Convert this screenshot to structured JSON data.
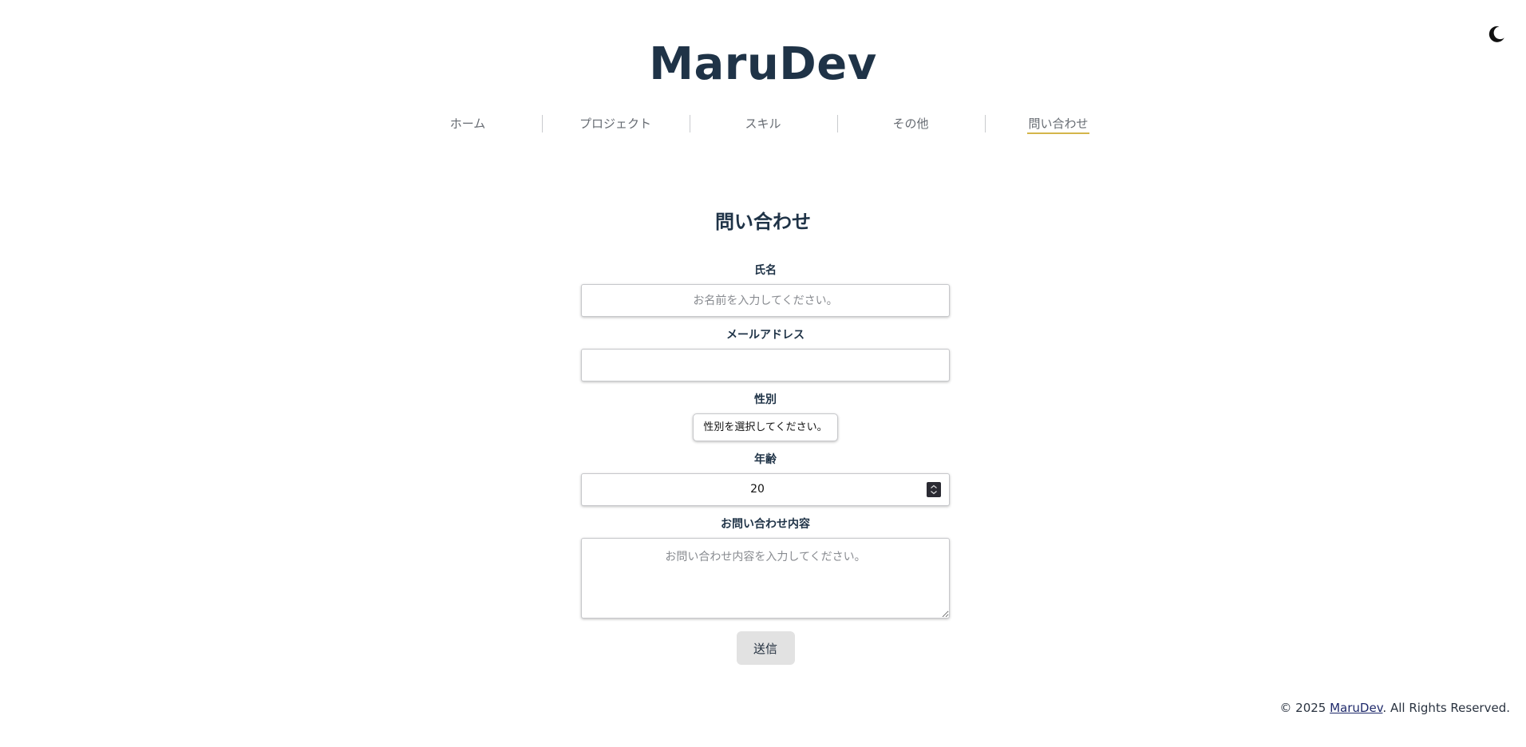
{
  "header": {
    "site_title": "MaruDev",
    "theme_toggle_icon": "moon-icon"
  },
  "nav": {
    "items": [
      {
        "label": "ホーム",
        "active": false
      },
      {
        "label": "プロジェクト",
        "active": false
      },
      {
        "label": "スキル",
        "active": false
      },
      {
        "label": "その他",
        "active": false
      },
      {
        "label": "問い合わせ",
        "active": true
      }
    ],
    "active_underline_color": "#d4b64a"
  },
  "contact": {
    "heading": "問い合わせ",
    "name": {
      "label": "氏名",
      "value": "",
      "placeholder": "お名前を入力してください。"
    },
    "email": {
      "label": "メールアドレス",
      "value": "",
      "placeholder": ""
    },
    "gender": {
      "label": "性別",
      "selected": "性別を選択してください。"
    },
    "age": {
      "label": "年齢",
      "value": "20"
    },
    "message": {
      "label": "お問い合わせ内容",
      "value": "",
      "placeholder": "お問い合わせ内容を入力してください。"
    },
    "submit_label": "送信"
  },
  "footer": {
    "prefix": "© 2025 ",
    "link_text": "MaruDev",
    "suffix": ". All Rights Reserved."
  }
}
